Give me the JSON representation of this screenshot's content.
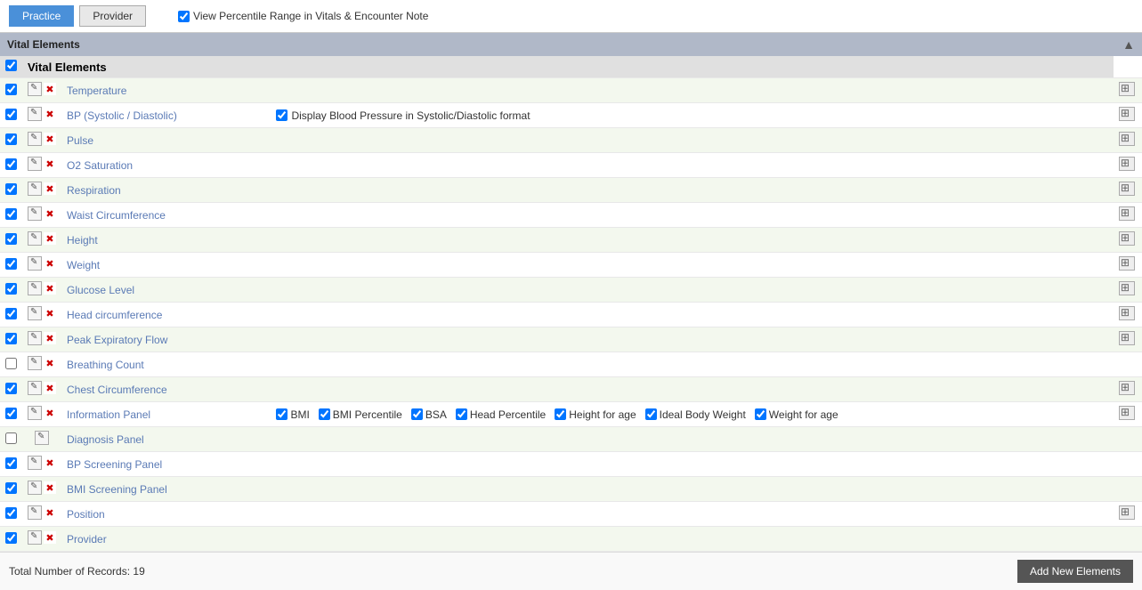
{
  "tabs": [
    {
      "label": "Practice",
      "active": true
    },
    {
      "label": "Provider",
      "active": false
    }
  ],
  "percentile_checkbox": {
    "checked": true,
    "label": "View Percentile Range in Vitals & Encounter Note"
  },
  "section_title": "Vital Elements",
  "header_row": {
    "label": "Vital Elements"
  },
  "rows": [
    {
      "id": 1,
      "checked": true,
      "has_edit": true,
      "has_del": true,
      "name": "Temperature",
      "extra": "",
      "has_move": true,
      "name_style": "blue"
    },
    {
      "id": 2,
      "checked": true,
      "has_edit": true,
      "has_del": true,
      "name": "BP (Systolic / Diastolic)",
      "extra": "Display Blood Pressure in Systolic/Diastolic format",
      "extra_checked": true,
      "has_move": true,
      "name_style": "blue"
    },
    {
      "id": 3,
      "checked": true,
      "has_edit": true,
      "has_del": true,
      "name": "Pulse",
      "extra": "",
      "has_move": true,
      "name_style": "blue"
    },
    {
      "id": 4,
      "checked": true,
      "has_edit": true,
      "has_del": true,
      "name": "O2 Saturation",
      "extra": "",
      "has_move": true,
      "name_style": "blue"
    },
    {
      "id": 5,
      "checked": true,
      "has_edit": true,
      "has_del": true,
      "name": "Respiration",
      "extra": "",
      "has_move": true,
      "name_style": "blue"
    },
    {
      "id": 6,
      "checked": true,
      "has_edit": true,
      "has_del": true,
      "name": "Waist Circumference",
      "extra": "",
      "has_move": true,
      "name_style": "blue"
    },
    {
      "id": 7,
      "checked": true,
      "has_edit": true,
      "has_del": true,
      "name": "Height",
      "extra": "",
      "has_move": true,
      "name_style": "blue"
    },
    {
      "id": 8,
      "checked": true,
      "has_edit": true,
      "has_del": true,
      "name": "Weight",
      "extra": "",
      "has_move": true,
      "name_style": "blue"
    },
    {
      "id": 9,
      "checked": true,
      "has_edit": true,
      "has_del": true,
      "name": "Glucose Level",
      "extra": "",
      "has_move": true,
      "name_style": "blue"
    },
    {
      "id": 10,
      "checked": true,
      "has_edit": true,
      "has_del": true,
      "name": "Head circumference",
      "extra": "",
      "has_move": true,
      "name_style": "blue"
    },
    {
      "id": 11,
      "checked": true,
      "has_edit": true,
      "has_del": true,
      "name": "Peak Expiratory Flow",
      "extra": "",
      "has_move": true,
      "name_style": "blue"
    },
    {
      "id": 12,
      "checked": false,
      "has_edit": true,
      "has_del": true,
      "name": "Breathing Count",
      "extra": "",
      "has_move": false,
      "name_style": "blue"
    },
    {
      "id": 13,
      "checked": true,
      "has_edit": true,
      "has_del": true,
      "name": "Chest Circumference",
      "extra": "",
      "has_move": true,
      "name_style": "blue"
    },
    {
      "id": 14,
      "checked": true,
      "has_edit": true,
      "has_del": true,
      "name": "Information Panel",
      "extra": "",
      "has_move": true,
      "name_style": "blue",
      "is_info": true,
      "info_items": [
        {
          "label": "BMI",
          "checked": true
        },
        {
          "label": "BMI Percentile",
          "checked": true
        },
        {
          "label": "BSA",
          "checked": true
        },
        {
          "label": "Head Percentile",
          "checked": true
        },
        {
          "label": "Height for age",
          "checked": true
        },
        {
          "label": "Ideal Body Weight",
          "checked": true
        },
        {
          "label": "Weight for age",
          "checked": true
        }
      ]
    },
    {
      "id": 15,
      "checked": false,
      "has_edit": true,
      "has_del": false,
      "name": "Diagnosis Panel",
      "extra": "",
      "has_move": false,
      "name_style": "blue"
    },
    {
      "id": 16,
      "checked": true,
      "has_edit": true,
      "has_del": true,
      "name": "BP Screening Panel",
      "extra": "",
      "has_move": false,
      "name_style": "blue"
    },
    {
      "id": 17,
      "checked": true,
      "has_edit": true,
      "has_del": true,
      "name": "BMI Screening Panel",
      "extra": "",
      "has_move": false,
      "name_style": "blue"
    },
    {
      "id": 18,
      "checked": true,
      "has_edit": true,
      "has_del": true,
      "name": "Position",
      "extra": "",
      "has_move": true,
      "name_style": "blue"
    },
    {
      "id": 19,
      "checked": true,
      "has_edit": true,
      "has_del": true,
      "name": "Provider",
      "extra": "",
      "has_move": false,
      "name_style": "blue"
    }
  ],
  "footer": {
    "total_label": "Total Number of Records: 19",
    "add_button": "Add New Elements"
  }
}
